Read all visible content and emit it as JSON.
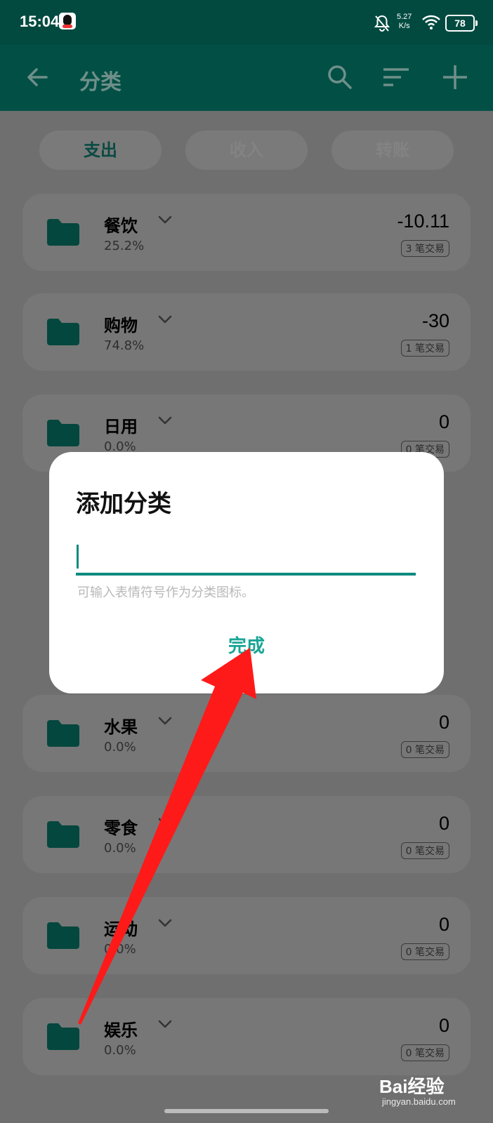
{
  "status_bar": {
    "time": "15:04",
    "net_speed": "5.27",
    "net_unit": "K/s",
    "battery": "78"
  },
  "app_bar": {
    "title": "分类",
    "icons": [
      "back-arrow-icon",
      "search-icon",
      "sort-icon",
      "add-icon"
    ]
  },
  "tabs": [
    {
      "label": "支出",
      "active": true
    },
    {
      "label": "收入",
      "active": false
    },
    {
      "label": "转账",
      "active": false
    }
  ],
  "categories": [
    {
      "name": "餐饮",
      "percent": "25.2%",
      "amount": "-10.11",
      "count": "3 笔交易"
    },
    {
      "name": "购物",
      "percent": "74.8%",
      "amount": "-30",
      "count": "1 笔交易"
    },
    {
      "name": "日用",
      "percent": "0.0%",
      "amount": "0",
      "count": "0 笔交易"
    },
    {
      "name": "水果",
      "percent": "0.0%",
      "amount": "0",
      "count": "0 笔交易"
    },
    {
      "name": "零食",
      "percent": "0.0%",
      "amount": "0",
      "count": "0 笔交易"
    },
    {
      "name": "运动",
      "percent": "0.0%",
      "amount": "0",
      "count": "0 笔交易"
    },
    {
      "name": "娱乐",
      "percent": "0.0%",
      "amount": "0",
      "count": "0 笔交易"
    }
  ],
  "dialog": {
    "title": "添加分类",
    "input_value": "",
    "hint": "可输入表情符号作为分类图标。",
    "done_label": "完成"
  },
  "watermark": {
    "brand": "Bai经验",
    "url": "jingyan.baidu.com"
  },
  "colors": {
    "primary": "#025045",
    "accent": "#18a596",
    "annotation_arrow": "#ff1a1a"
  }
}
